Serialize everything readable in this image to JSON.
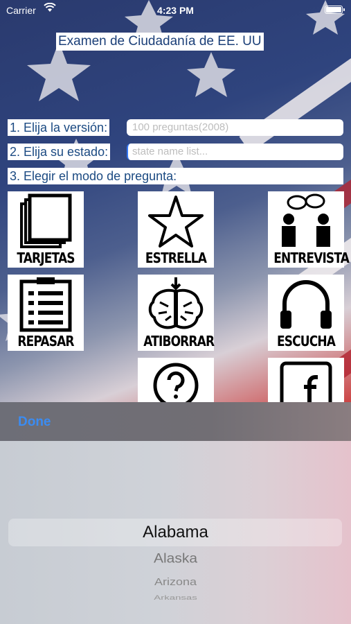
{
  "status": {
    "carrier": "Carrier",
    "time": "4:23 PM"
  },
  "title": "Examen de Ciudadanía de EE. UU",
  "steps": {
    "version_label": "1. Elija la versión:",
    "version_value": "100 preguntas(2008)",
    "state_label": "2. Elija su estado:",
    "state_placeholder": "state name list...",
    "mode_label": "3. Elegir el modo de pregunta:"
  },
  "modes": [
    {
      "label": "TARJETAS",
      "icon": "cards-icon"
    },
    {
      "label": "ESTRELLA",
      "icon": "star-icon"
    },
    {
      "label": "ENTREVISTA",
      "icon": "interview-icon"
    },
    {
      "label": "REPASAR",
      "icon": "clipboard-icon"
    },
    {
      "label": "ATIBORRAR",
      "icon": "brain-icon"
    },
    {
      "label": "ESCUCHA",
      "icon": "headphones-icon"
    },
    {
      "label": "",
      "icon": "question-icon"
    },
    {
      "label": "",
      "icon": "facebook-icon"
    }
  ],
  "picker": {
    "done_label": "Done",
    "options": [
      "Alabama",
      "Alaska",
      "Arizona",
      "Arkansas"
    ],
    "selected": "Alabama"
  }
}
